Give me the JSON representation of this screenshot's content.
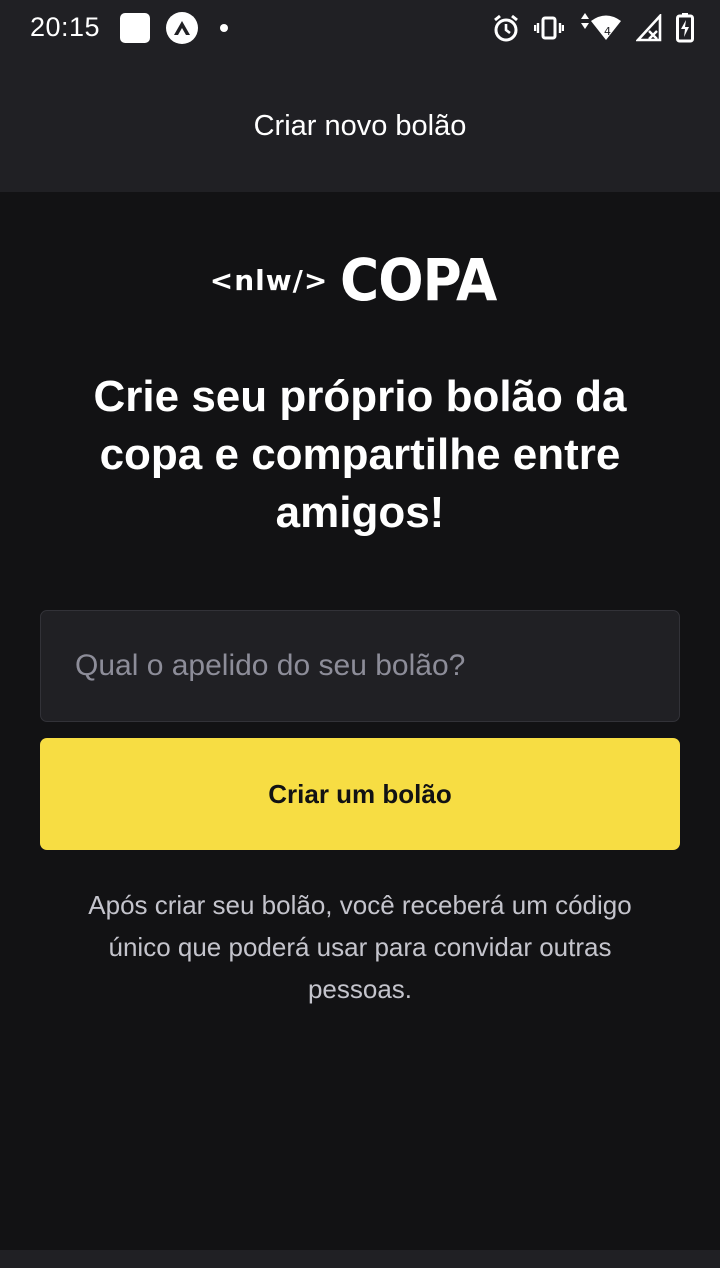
{
  "status_bar": {
    "time": "20:15",
    "left_icons": [
      "app-square-icon",
      "expo-icon",
      "notification-dot-icon"
    ],
    "right_icons": [
      "alarm-icon",
      "vibrate-icon",
      "wifi-icon",
      "signal-icon",
      "battery-charging-icon"
    ],
    "wifi_badge": "4"
  },
  "header": {
    "title": "Criar novo bolão"
  },
  "logo": {
    "prefix": "<nlw/>",
    "word": "COPA"
  },
  "headline": "Crie seu próprio bolão da copa e compartilhe entre amigos!",
  "form": {
    "input_value": "",
    "input_placeholder": "Qual o apelido do seu bolão?",
    "button_label": "Criar um bolão"
  },
  "helper_text": "Após criar seu bolão, você receberá um código único que poderá usar para convidar outras pessoas.",
  "colors": {
    "background": "#121214",
    "surface": "#202024",
    "accent": "#f7dd43",
    "text_muted": "#c4c4cc",
    "placeholder": "#8d8d99"
  }
}
